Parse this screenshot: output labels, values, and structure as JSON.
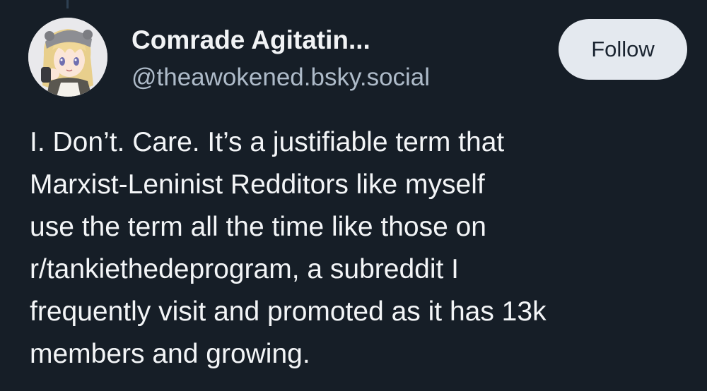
{
  "author": {
    "display_name": "Comrade Agitatin...",
    "handle": "@theawokened.bsky.social",
    "avatar_icon": "anime-character-avatar"
  },
  "actions": {
    "follow_label": "Follow"
  },
  "post": {
    "text": "I. Don’t. Care. It’s a justifiable term that\nMarxist-Leninist Redditors like myself\nuse the term all the time like those on\nr/tankiethedeprogram, a subreddit I\nfrequently visit and promoted as it has 13k\nmembers and growing."
  },
  "colors": {
    "background": "#161e27",
    "text_primary": "#f1f3f5",
    "text_secondary": "#aebbc9",
    "button_bg": "#e4e9ef",
    "button_text": "#1a2430"
  }
}
